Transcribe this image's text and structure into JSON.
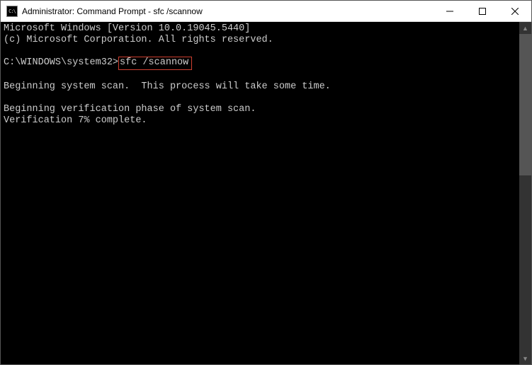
{
  "window": {
    "title": "Administrator: Command Prompt - sfc  /scannow",
    "icon_text": "C:\\"
  },
  "terminal": {
    "line1": "Microsoft Windows [Version 10.0.19045.5440]",
    "line2": "(c) Microsoft Corporation. All rights reserved.",
    "blank": "",
    "prompt": "C:\\WINDOWS\\system32>",
    "command": "sfc /scannow",
    "line3": "Beginning system scan.  This process will take some time.",
    "line4": "Beginning verification phase of system scan.",
    "line5": "Verification 7% complete."
  }
}
